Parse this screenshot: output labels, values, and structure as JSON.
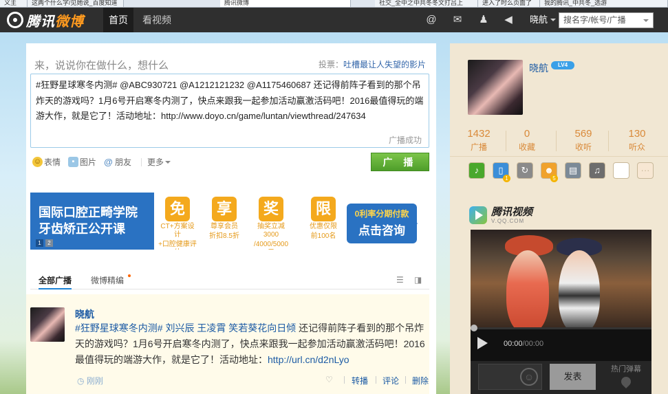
{
  "browser_tabs": [
    {
      "label": "义主",
      "active": false
    },
    {
      "label": "这两个什么字/见她说_百度知道",
      "active": false
    },
    {
      "label": "腾讯微博",
      "active": true
    },
    {
      "label": "社交_全中之中共冬冬文打吕上",
      "active": false
    },
    {
      "label": "进入了时么页面了",
      "active": false
    },
    {
      "label": "我的腾讯_中共冬_选游",
      "active": false
    }
  ],
  "topbar": {
    "logo_text": "腾讯",
    "logo_text_accent": "微博",
    "nav": [
      "首页",
      "看视频"
    ],
    "icons": [
      "at-icon",
      "mail-icon",
      "user-icon",
      "speaker-icon"
    ],
    "username": "晓航",
    "search_placeholder": "搜名字/帐号/广播"
  },
  "composer": {
    "prompt": "来，说说你在做什么，想什么",
    "poll_prefix": "投票：",
    "poll_link": "吐槽最让人失望的影片",
    "text": "#狂野星球寒冬内测# @ABC930721 @A1212121232 @A1175460687 还记得前阵子看到的那个吊炸天的游戏吗？1月6号开启寒冬内测了，快点来跟我一起参加活动赢激活码吧！2016最值得玩的端游大作，就是它了！活动地址：http://www.doyo.cn/game/luntan/viewthread/247634",
    "status": "广播成功",
    "tools": [
      "表情",
      "图片",
      "朋友",
      "更多"
    ],
    "submit": "广 播"
  },
  "ad": {
    "title_line1": "国际口腔正畸学院",
    "title_line2": "牙齿矫正公开课",
    "pages": [
      "1",
      "2"
    ],
    "badges": [
      {
        "glyph": "免",
        "line1": "CT+方案设计",
        "line2": "+口腔健康评估"
      },
      {
        "glyph": "享",
        "line1": "尊享会员",
        "line2": "折扣8.5折"
      },
      {
        "glyph": "奖",
        "line1": "抽奖立减3000",
        "line2": "/4000/5000元"
      },
      {
        "glyph": "限",
        "line1": "优惠仅限",
        "line2": "前100名"
      }
    ],
    "cta_line1": "0利率分期付款",
    "cta_line2": "点击咨询"
  },
  "feed_tabs": [
    "全部广播",
    "微博精编"
  ],
  "post": {
    "author": "晓航",
    "tags": "#狂野星球寒冬内测# 刘兴辰 王凌霄 笑若葵花向日倾",
    "text": " 还记得前阵子看到的那个吊炸天的游戏吗？1月6号开启寒冬内测了，快点来跟我一起参加活动赢激活码吧！2016最值得玩的端游大作，就是它了！活动地址：",
    "link": "http://url.cn/d2nLyo",
    "time": "刚刚",
    "actions": [
      "转播",
      "评论",
      "删除"
    ]
  },
  "profile": {
    "name": "晓航",
    "level": "LV4",
    "stats": [
      {
        "num": "1432",
        "label": "广播"
      },
      {
        "num": "0",
        "label": "收藏"
      },
      {
        "num": "569",
        "label": "收听"
      },
      {
        "num": "130",
        "label": "听众"
      }
    ],
    "app_badges": [
      "1",
      "5"
    ]
  },
  "video": {
    "brand": "腾讯视频",
    "brand_sub": "V.QQ.COM",
    "current": "00:00",
    "duration": "/00:00",
    "send": "发表",
    "hot": "热门弹幕"
  },
  "colors": {
    "topbar": "#2f2f2f",
    "link_blue": "#1b5aa4",
    "submit_green": "#5aab33",
    "stat_orange": "#d98a3a",
    "ad_blue": "#2a72c2",
    "ad_orange": "#f4a91d"
  }
}
